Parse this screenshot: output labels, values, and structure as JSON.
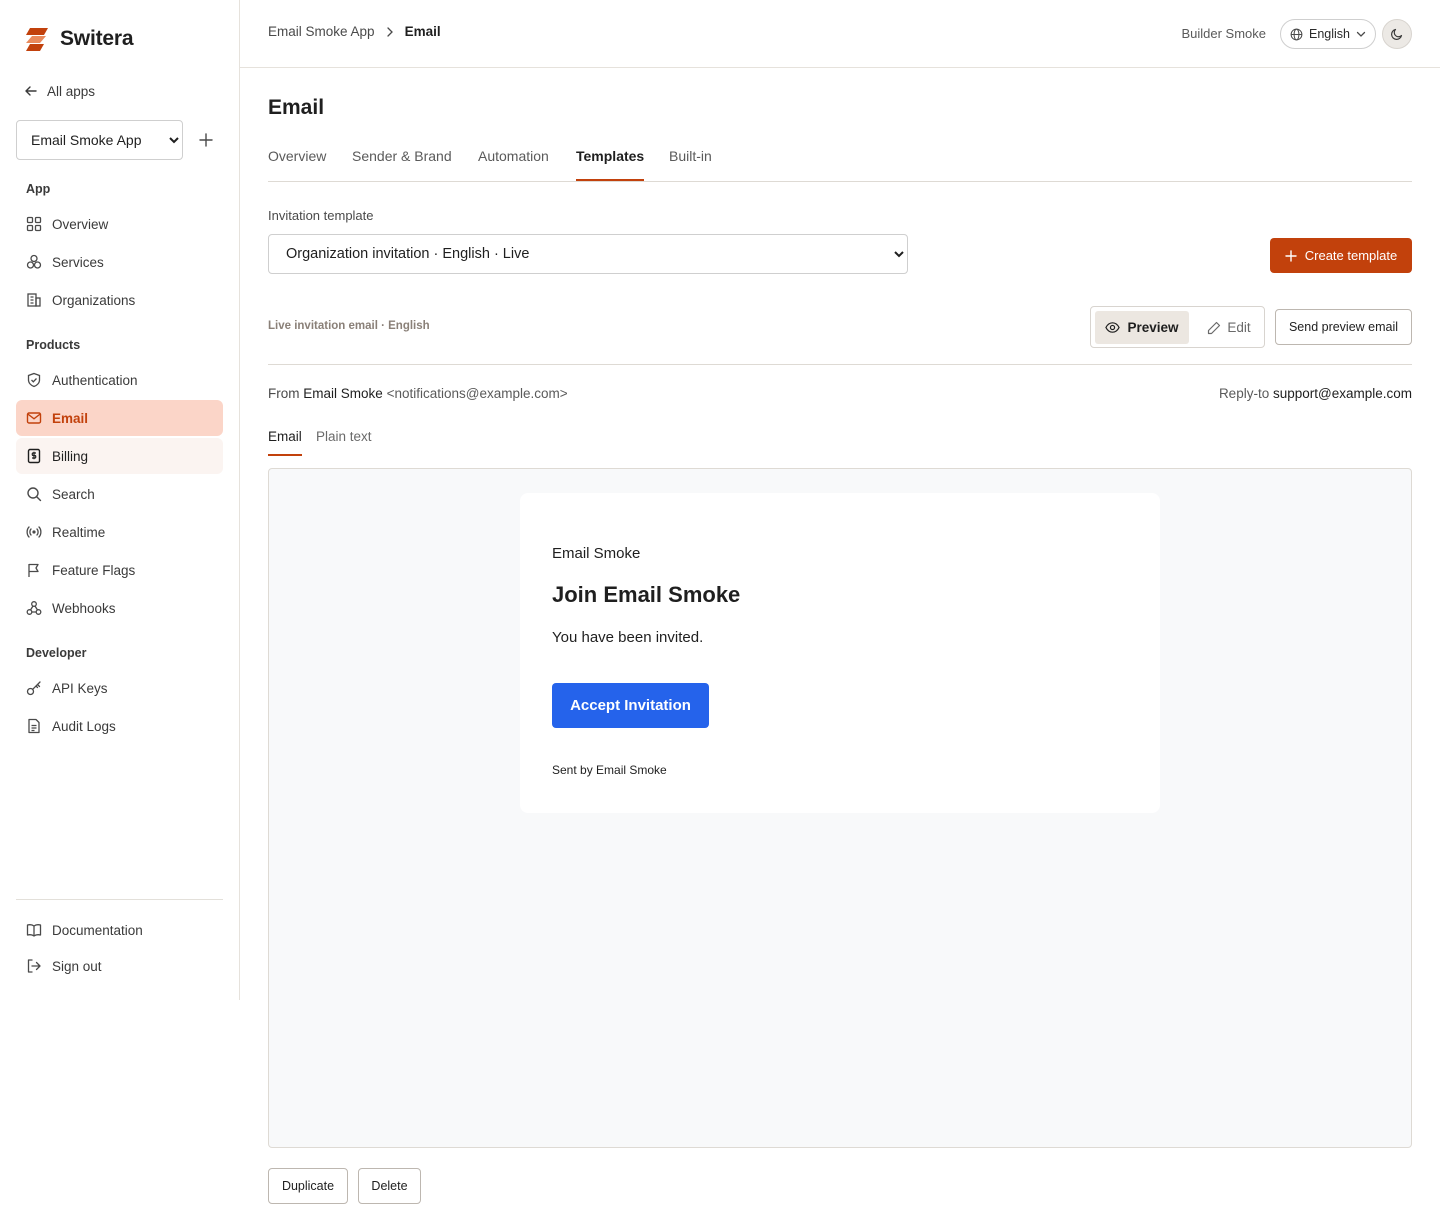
{
  "brand": {
    "name": "Switera",
    "accent": "#c2410c"
  },
  "sidebar": {
    "back_label": "All apps",
    "app_select": {
      "value": "Email Smoke App",
      "options": [
        "Email Smoke App"
      ]
    },
    "sections": {
      "app": "App",
      "products": "Products",
      "developer": "Developer"
    },
    "items": {
      "overview": "Overview",
      "services": "Services",
      "organizations": "Organizations",
      "authentication": "Authentication",
      "email": "Email",
      "billing": "Billing",
      "search": "Search",
      "realtime": "Realtime",
      "feature_flags": "Feature Flags",
      "webhooks": "Webhooks",
      "api_keys": "API Keys",
      "audit_logs": "Audit Logs",
      "documentation": "Documentation",
      "sign_out": "Sign out"
    }
  },
  "header": {
    "breadcrumb": [
      "Email Smoke App",
      "Email"
    ],
    "user": "Builder Smoke",
    "language": "English"
  },
  "page": {
    "title": "Email",
    "tabs": [
      "Overview",
      "Sender & Brand",
      "Automation",
      "Templates",
      "Built-in"
    ],
    "active_tab": "Templates"
  },
  "template": {
    "label": "Invitation template",
    "selected": "Organization invitation · English · Live",
    "create_label": "Create template",
    "status_label": "Live invitation email · English",
    "preview_label": "Preview",
    "edit_label": "Edit",
    "send_preview_label": "Send preview email"
  },
  "envelope": {
    "from_prefix": "From",
    "from_name": "Email Smoke",
    "from_address": "<notifications@example.com>",
    "reply_prefix": "Reply-to",
    "reply_address": "support@example.com"
  },
  "view_tabs": [
    "Email",
    "Plain text"
  ],
  "email_preview": {
    "brand": "Email Smoke",
    "heading": "Join Email Smoke",
    "body": "You have been invited.",
    "cta": "Accept Invitation",
    "cta_color": "#2563eb",
    "footer": "Sent by Email Smoke"
  },
  "actions": {
    "duplicate": "Duplicate",
    "delete": "Delete"
  }
}
